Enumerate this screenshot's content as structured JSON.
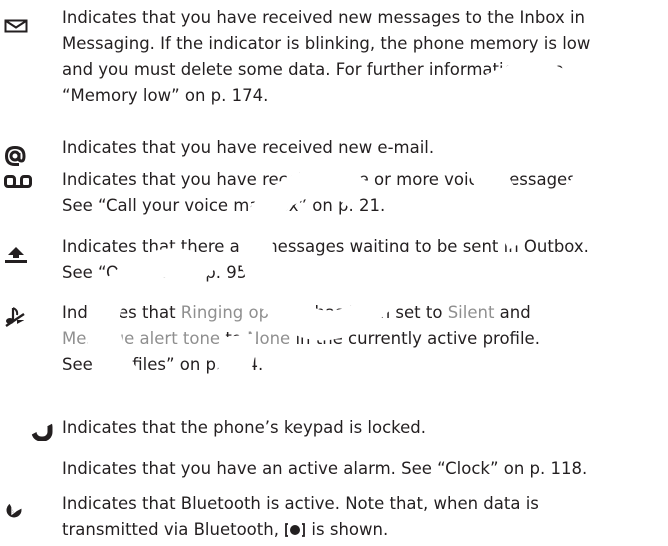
{
  "entries": [
    {
      "icon": "envelope-icon",
      "lines": [
        "Indicates that you have received new messages to the Inbox in",
        "Messaging. If the indicator is blinking, the phone memory is low",
        "and you must delete some data. For further information, see",
        "“Memory low” on p. 174."
      ]
    },
    {
      "icon": "at-sign-icon",
      "lines": [
        "Indicates that you have received new e-mail."
      ]
    },
    {
      "icon": "voicemail-icon",
      "lines": [
        "Indicates that you have received one or more voice messages.",
        "See “Call your voice mailbox” on p. 21."
      ]
    },
    {
      "icon": "outbox-icon",
      "lines": [
        "Indicates that there are messages waiting to be sent in Outbox.",
        "See “Outbox” on p. 95."
      ]
    },
    {
      "icon": "silent-icon",
      "lines": [
        {
          "a": "Indicates that ",
          "b": "Ringing options",
          "c": " has been set to ",
          "d": "Silent",
          "e": " and"
        },
        {
          "a": "",
          "b": "Message alert tone",
          "c": " to ",
          "d": "None",
          "e": " in the currently active profile."
        },
        "See “Profiles” on p. 104."
      ]
    },
    {
      "icon": "keypad-lock-icon",
      "lines": [
        "Indicates that the phone’s keypad is locked."
      ]
    },
    {
      "icon": "alarm-icon",
      "lines": [
        "Indicates that you have an active alarm. See “Clock” on p. 118."
      ]
    },
    {
      "icon": "bluetooth-icon",
      "lines": [
        "Indicates that Bluetooth is active. Note that, when data is",
        {
          "before": "transmitted via Bluetooth, ",
          "icon": "bluetooth-transmit-icon",
          "after": " is shown."
        }
      ]
    }
  ],
  "watermark": "FCC DRAFT",
  "colors": {
    "text": "#231f20",
    "highlight": "#8f8f8f",
    "icon": "#231f20",
    "watermark": "#ffffff"
  }
}
